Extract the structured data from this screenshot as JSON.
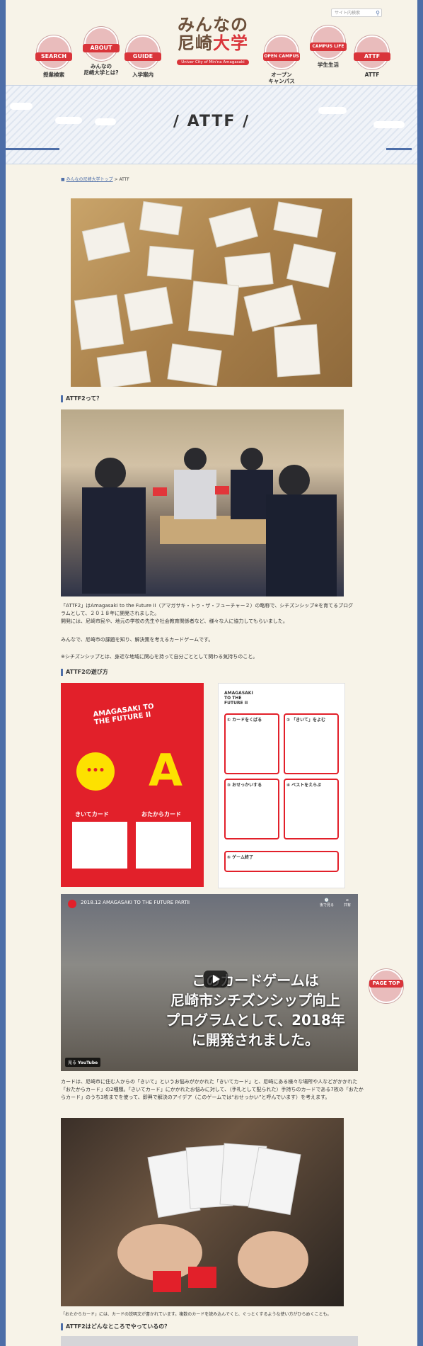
{
  "header": {
    "search_placeholder": "サイト内検索",
    "logo_line1": "みんなの",
    "logo_line2a": "尼崎",
    "logo_line2b": "大学",
    "logo_sub": "Univer City of Min'na Amagasaki",
    "nav": [
      {
        "tag": "SEARCH",
        "caption": "授業検索"
      },
      {
        "tag": "ABOUT",
        "caption": "みんなの\n尼崎大学とは?"
      },
      {
        "tag": "GUIDE",
        "caption": "入学案内"
      },
      {
        "tag": "OPEN CAMPUS",
        "caption": "オープン\nキャンパス"
      },
      {
        "tag": "CAMPUS LIFE",
        "caption": "学生生活"
      },
      {
        "tag": "ATTF",
        "caption": "ATTF"
      }
    ]
  },
  "banner": {
    "title": "ATTF"
  },
  "breadcrumb": {
    "home": "みんなの尼崎大学トップ",
    "sep": " > ",
    "current": "ATTF"
  },
  "sections": {
    "h1": "ATTF2って？",
    "p1a": "「ATTF2」はAmagasaki to the Future II（アマガサキ・トゥ・ザ・フューチャー２）の略称で、シチズンシップ※を育てるプログラムとして、２０１８年に開発されました。",
    "p1b": "開発には、尼崎市民や、地元の学校の先生や社会教育関係者など、様々な人に協力してもらいました。",
    "p2": "みんなで、尼崎市の課題を知り、解決策を考えるカードゲームです。",
    "p3": "※シチズンシップとは、身近な地域に関心を持って自分ごととして関わる気持ちのこと。",
    "h2": "ATTF2の遊び方",
    "card_left": {
      "logo": "AMAGASAKI TO THE FUTURE II",
      "label_a": "きいてカード",
      "label_b": "おたからカード"
    },
    "card_right_steps": [
      "カードをくばる",
      "「きいて」をよむ",
      "おせっかいする",
      "ベストをえらぶ",
      "ゲーム終了"
    ],
    "video": {
      "title": "2018.12 AMAGASAKI TO THE FUTURE PARTⅡ",
      "later": "後で見る",
      "share": "共有",
      "overlay": "このカードゲームは\n尼崎市シチズンシップ向上\nプログラムとして、2018年\nに開発されました。",
      "watch": "見る",
      "yt": "YouTube"
    },
    "p4": "カードは、尼崎市に住む人からの「きいて」というお悩みがかかれた「きいてカード」と、尼崎にある様々な場所や人などがかかれた「おたからカード」の2種類。「きいてカード」にかかれたお悩みに対して、（手札として配られた）手持ちのカードである7枚の「おたからカード」のうち3枚までを使って、即興で解決のアイデア（このゲームでは“おせっかい”と呼んでいます）を考えます。",
    "caption1": "「おたからカード」には、カードの説明文が書かれています。複数のカードを読み込んでくと、ぐっとくするような使い方がひらめくことも。",
    "h3": "ATTF2はどんなところでやっているの？"
  },
  "pagetop": "PAGE TOP",
  "colors": {
    "accent": "#d9343a",
    "brand_blue": "#4d6ea8",
    "bg": "#f7f3e8"
  }
}
